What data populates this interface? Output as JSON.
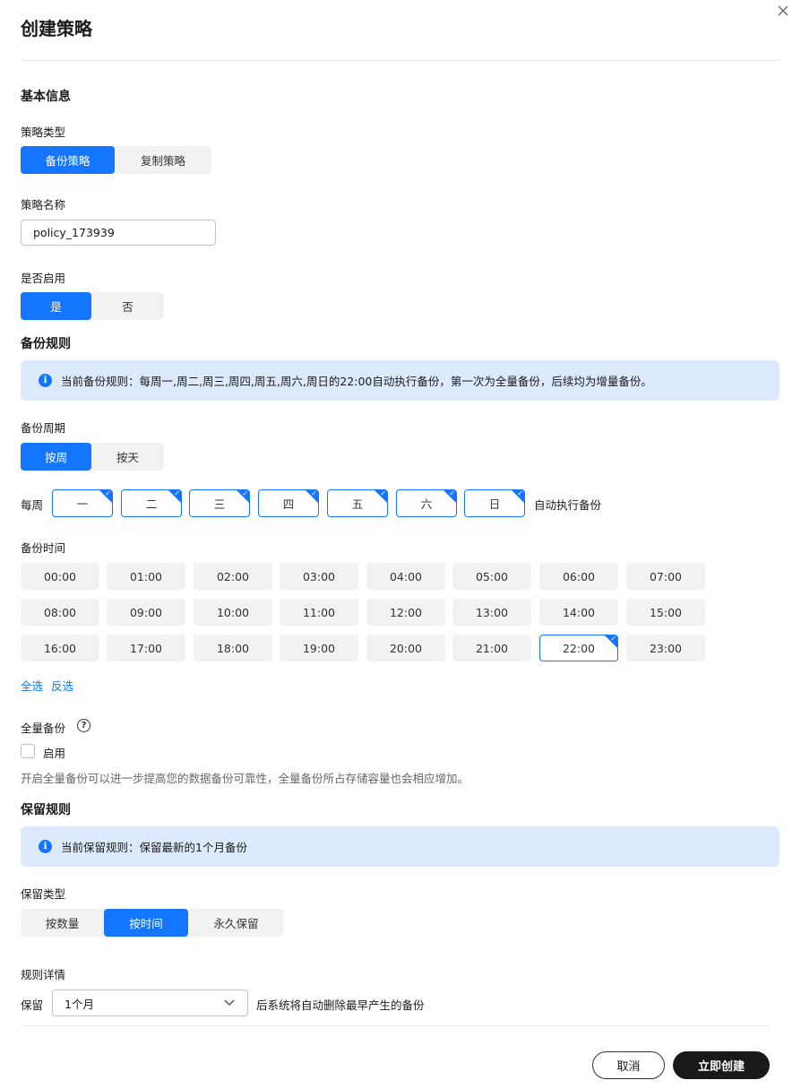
{
  "dialog": {
    "title": "创建策略"
  },
  "basic": {
    "section_title": "基本信息",
    "type_label": "策略类型",
    "type_options": [
      "备份策略",
      "复制策略"
    ],
    "type_selected": "备份策略",
    "name_label": "策略名称",
    "name_value": "policy_173939",
    "enable_label": "是否启用",
    "enable_options": [
      "是",
      "否"
    ],
    "enable_selected": "是"
  },
  "backup_rule": {
    "section_title": "备份规则",
    "info": "当前备份规则：每周一,周二,周三,周四,周五,周六,周日的22:00自动执行备份，第一次为全量备份，后续均为增量备份。",
    "period_label": "备份周期",
    "period_options": [
      "按周",
      "按天"
    ],
    "period_selected": "按周",
    "weekly_prefix": "每周",
    "weekly_suffix": "自动执行备份",
    "days": [
      "一",
      "二",
      "三",
      "四",
      "五",
      "六",
      "日"
    ],
    "time_label": "备份时间",
    "times": [
      "00:00",
      "01:00",
      "02:00",
      "03:00",
      "04:00",
      "05:00",
      "06:00",
      "07:00",
      "08:00",
      "09:00",
      "10:00",
      "11:00",
      "12:00",
      "13:00",
      "14:00",
      "15:00",
      "16:00",
      "17:00",
      "18:00",
      "19:00",
      "20:00",
      "21:00",
      "22:00",
      "23:00"
    ],
    "time_selected": "22:00",
    "select_all": "全选",
    "invert": "反选",
    "full_backup_label": "全量备份",
    "full_backup_checkbox": "启用",
    "full_backup_hint": "开启全量备份可以进一步提高您的数据备份可靠性，全量备份所占存储容量也会相应增加。"
  },
  "retention": {
    "section_title": "保留规则",
    "info": "当前保留规则：保留最新的1个月备份",
    "type_label": "保留类型",
    "type_options": [
      "按数量",
      "按时间",
      "永久保留"
    ],
    "type_selected": "按时间",
    "detail_label": "规则详情",
    "keep_prefix": "保留",
    "keep_value": "1个月",
    "keep_suffix": "后系统将自动删除最早产生的备份"
  },
  "footer": {
    "cancel": "取消",
    "create": "立即创建"
  },
  "colors": {
    "accent": "#1476ff",
    "info_bg": "#ddeafd",
    "primary_button": "#191919"
  }
}
